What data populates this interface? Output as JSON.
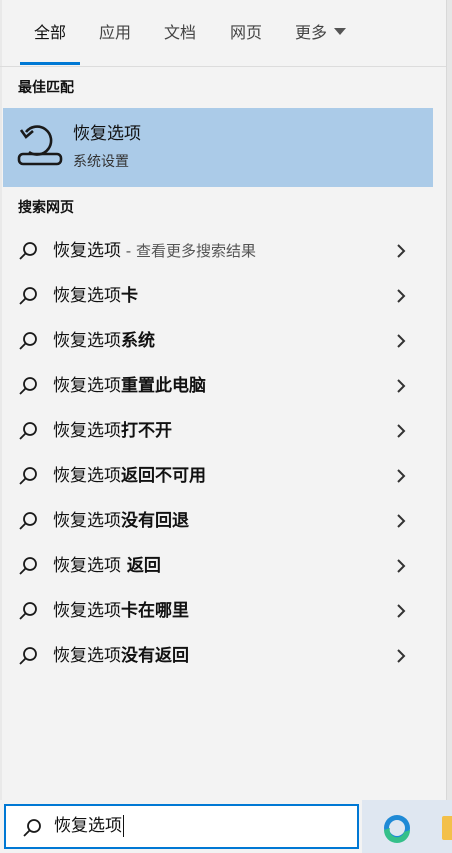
{
  "tabs": [
    {
      "label": "全部",
      "active": true
    },
    {
      "label": "应用",
      "active": false
    },
    {
      "label": "文档",
      "active": false
    },
    {
      "label": "网页",
      "active": false
    },
    {
      "label": "更多",
      "active": false
    }
  ],
  "best_match": {
    "section_title": "最佳匹配",
    "title": "恢复选项",
    "subtitle": "系统设置",
    "icon": "recovery-icon"
  },
  "web": {
    "section_title": "搜索网页",
    "results": [
      {
        "prefix": "恢复选项",
        "suffix": "",
        "hint": " - 查看更多搜索结果"
      },
      {
        "prefix": "恢复选项",
        "suffix": "卡",
        "hint": ""
      },
      {
        "prefix": "恢复选项",
        "suffix": "系统",
        "hint": ""
      },
      {
        "prefix": "恢复选项",
        "suffix": "重置此电脑",
        "hint": ""
      },
      {
        "prefix": "恢复选项",
        "suffix": "打不开",
        "hint": ""
      },
      {
        "prefix": "恢复选项",
        "suffix": "返回不可用",
        "hint": ""
      },
      {
        "prefix": "恢复选项",
        "suffix": "没有回退",
        "hint": ""
      },
      {
        "prefix": "恢复选项",
        "suffix": " 返回",
        "hint": ""
      },
      {
        "prefix": "恢复选项",
        "suffix": "卡在哪里",
        "hint": ""
      },
      {
        "prefix": "恢复选项",
        "suffix": "没有返回",
        "hint": ""
      }
    ]
  },
  "search": {
    "value": "恢复选项"
  },
  "colors": {
    "accent": "#0078d4",
    "selected": "#abcbe8",
    "background": "#f3f3f3"
  }
}
